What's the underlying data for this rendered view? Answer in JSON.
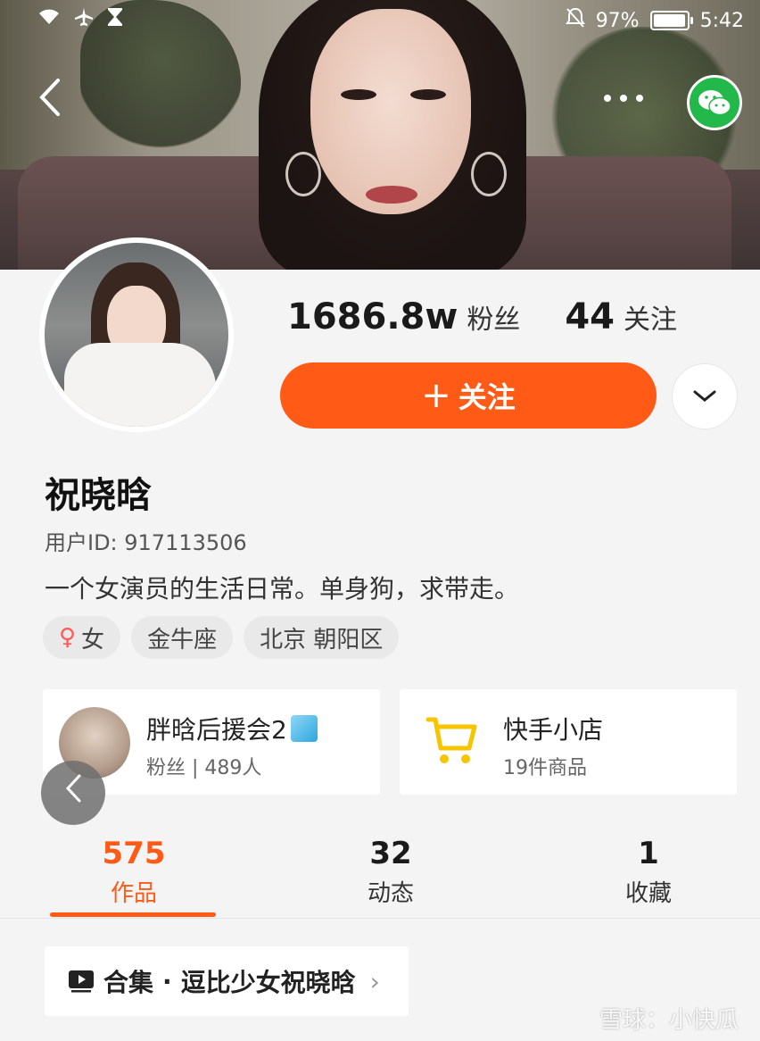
{
  "status_bar": {
    "battery_percent": "97%",
    "time": "5:42",
    "battery_level": 0.97
  },
  "header": {
    "back_icon": "chevron-left-icon",
    "more_icon": "more-dots-icon",
    "share_icon": "wechat-icon"
  },
  "profile": {
    "fans_count": "1686.8w",
    "fans_label": "粉丝",
    "following_count": "44",
    "following_label": "关注",
    "follow_button_plus": "+",
    "follow_button_label": "关注",
    "name": "祝晓晗",
    "user_id": "用户ID: 917113506",
    "bio": "一个女演员的生活日常。单身狗，求带走。",
    "tags": {
      "gender_icon": "♀",
      "gender": "女",
      "zodiac": "金牛座",
      "location": "北京 朝阳区"
    }
  },
  "cards": {
    "fan_group": {
      "title": "胖晗后援会2",
      "subtitle": "粉丝 | 489人"
    },
    "shop": {
      "title": "快手小店",
      "subtitle": "19件商品"
    }
  },
  "tabs": [
    {
      "count": "575",
      "label": "作品"
    },
    {
      "count": "32",
      "label": "动态"
    },
    {
      "count": "1",
      "label": "收藏"
    }
  ],
  "collection": {
    "label": "合集",
    "separator": "·",
    "name": "逗比少女祝晓晗",
    "chevron": "›"
  },
  "watermark": "雪球：小快瓜",
  "colors": {
    "accent": "#ff5a16",
    "wechat": "#23b84a"
  }
}
